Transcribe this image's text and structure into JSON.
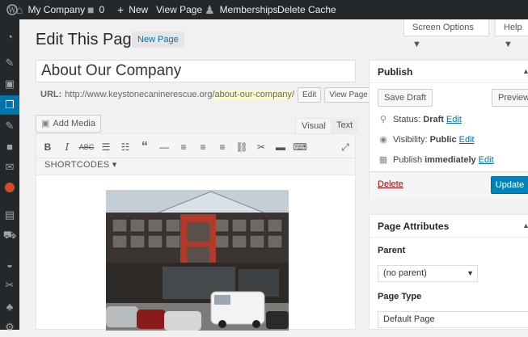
{
  "adminbar": {
    "wp_logo": "wordpress-logo",
    "site_name": "My Company",
    "comments_count": "0",
    "new_label": "New",
    "view_page": "View Page",
    "memberships": "Memberships",
    "delete_cache": "Delete Cache"
  },
  "header": {
    "title": "Edit This Page",
    "new_page": "New Page",
    "screen_options": "Screen Options ▼",
    "help": "Help ▼"
  },
  "post": {
    "title": "About Our Company",
    "url_label": "URL:",
    "url_base": "http://www.keystonecaninerescue.org/",
    "slug": "about-our-company",
    "url_trail": "/",
    "edit_button": "Edit",
    "view_button": "View Page"
  },
  "editor": {
    "add_media": "Add Media",
    "tab_visual": "Visual",
    "tab_text": "Text",
    "shortcodes": "SHORTCODES ▾"
  },
  "publish": {
    "title": "Publish",
    "save_draft": "Save Draft",
    "preview": "Preview",
    "status_label": "Status:",
    "status_value": "Draft",
    "visibility_label": "Visibility:",
    "visibility_value": "Public",
    "publish_label": "Publish",
    "publish_value": "immediately",
    "edit_link": "Edit",
    "delete": "Delete",
    "update": "Update"
  },
  "attributes": {
    "title": "Page Attributes",
    "parent_label": "Parent",
    "parent_value": "(no parent)",
    "type_label": "Page Type",
    "type_value": "Default Page"
  },
  "colors": {
    "adminbar": "#23282d",
    "accent": "#0073aa",
    "update_button": "#0085ba"
  }
}
